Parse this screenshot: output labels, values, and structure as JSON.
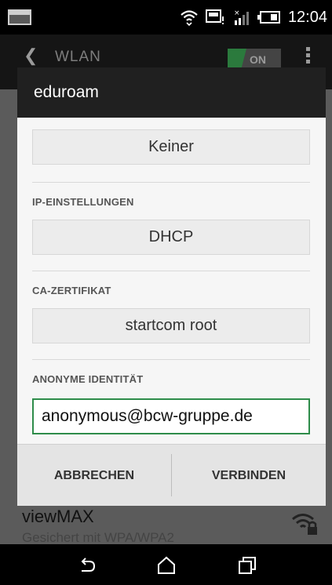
{
  "status_bar": {
    "time": "12:04"
  },
  "action_bar": {
    "back_icon": "chevron-left-icon",
    "title": "WLAN",
    "toggle_label": "ON"
  },
  "background_list": {
    "network_name": "viewMAX",
    "network_security": "Gesichert mit WPA/WPA2"
  },
  "dialog": {
    "title": "eduroam",
    "phase2_value": "Keiner",
    "ip_settings_label": "IP-EINSTELLUNGEN",
    "ip_settings_value": "DHCP",
    "ca_cert_label": "CA-ZERTIFIKAT",
    "ca_cert_value": "startcom root",
    "anon_identity_label": "ANONYME IDENTITÄT",
    "anon_identity_value": "anonymous@bcw-gruppe.de",
    "cancel_label": "ABBRECHEN",
    "connect_label": "VERBINDEN"
  },
  "colors": {
    "accent": "#2e8c4a",
    "dialog_title_bg": "#202020"
  }
}
